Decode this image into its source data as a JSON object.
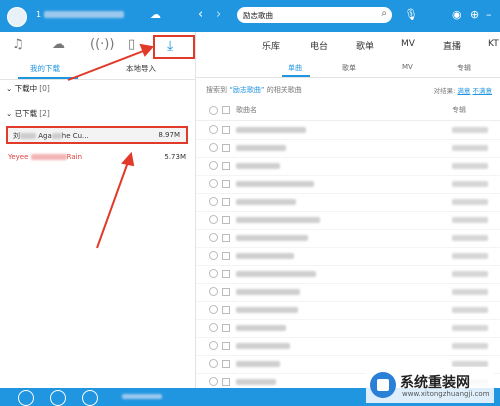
{
  "header": {
    "user_prefix": "1",
    "search_value": "励志歌曲",
    "search_icon": "search-icon"
  },
  "sidebar": {
    "tabs": {
      "mine": "我的下载",
      "local": "本地导入"
    },
    "downloading": {
      "label": "下载中",
      "count": "[0]"
    },
    "downloaded": {
      "label": "已下载",
      "count": "[2]"
    },
    "files": [
      {
        "name_start": "刘",
        "name_visible": "Aga",
        "name_end": "he Cu...",
        "size": "8.97M"
      },
      {
        "name_start": "Yeyee",
        "name_end": "Rain",
        "size": "5.73M"
      }
    ]
  },
  "main": {
    "nav": [
      "乐库",
      "电台",
      "歌单",
      "MV",
      "直播",
      "KT"
    ],
    "subnav": [
      "单曲",
      "歌单",
      "MV",
      "专辑"
    ],
    "search_info": {
      "prefix": "搜索到",
      "keyword": "“励志歌曲”",
      "suffix": "的相关歌曲"
    },
    "filter": {
      "label": "对结果:",
      "opt1": "满意",
      "opt2": "不满意"
    },
    "columns": {
      "name": "歌曲名",
      "album": "专辑"
    }
  },
  "watermark": {
    "text": "系统重装网",
    "url": "www.xitongzhuangji.com"
  },
  "colors": {
    "accent": "#2196e0",
    "highlight": "#e23a2a"
  }
}
